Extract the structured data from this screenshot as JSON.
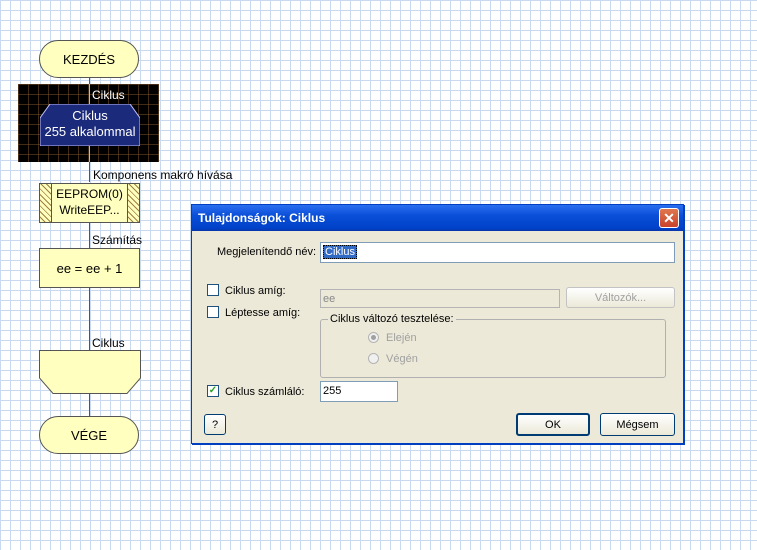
{
  "flowchart": {
    "start_label": "KEZDÉS",
    "loop_caption": "Ciklus",
    "loop_box_line1": "Ciklus",
    "loop_box_line2": "255 alkalommal",
    "component_caption": "Komponens makró hívása",
    "component_line1": "EEPROM(0)",
    "component_line2": "WriteEEP...",
    "calc_caption": "Számítás",
    "calc_text": "ee = ee + 1",
    "loop_end_caption": "Ciklus",
    "end_label": "VÉGE"
  },
  "dialog": {
    "title": "Tulajdonságok: Ciklus",
    "close_glyph": "✕",
    "display_name_label": "Megjelenítendő név:",
    "display_name_value": "Ciklus",
    "while_label": "Ciklus amíg:",
    "while_value": "ee",
    "variables_button": "Változók...",
    "step_label": "Léptesse amíg:",
    "test_group_label": "Ciklus változó tesztelése:",
    "radio_start": "Elején",
    "radio_end": "Végén",
    "counter_label": "Ciklus számláló:",
    "counter_checked_glyph": "✓",
    "counter_value": "255",
    "help_button": "?",
    "ok_button": "OK",
    "cancel_button": "Mégsem"
  }
}
